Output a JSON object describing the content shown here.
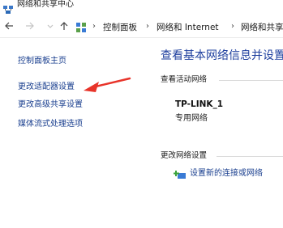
{
  "window": {
    "title": "网络和共享中心"
  },
  "address_bar": {
    "back_icon": "back-arrow-icon",
    "forward_icon": "forward-arrow-icon",
    "up_icon": "up-arrow-icon",
    "location_icon": "control-panel-icon",
    "breadcrumbs": [
      "控制面板",
      "网络和 Internet",
      "网络和共享"
    ]
  },
  "sidebar": {
    "items": [
      {
        "label": "控制面板主页"
      },
      {
        "label": "更改适配器设置"
      },
      {
        "label": "更改高级共享设置"
      },
      {
        "label": "媒体流式处理选项"
      }
    ],
    "highlight_color": "#e8342a"
  },
  "main": {
    "title": "查看基本网络信息并设置",
    "active_networks_label": "查看活动网络",
    "network": {
      "name": "TP-LINK_1",
      "type": "专用网络"
    },
    "change_settings_label": "更改网络设置",
    "setup_link": "设置新的连接或网络"
  }
}
